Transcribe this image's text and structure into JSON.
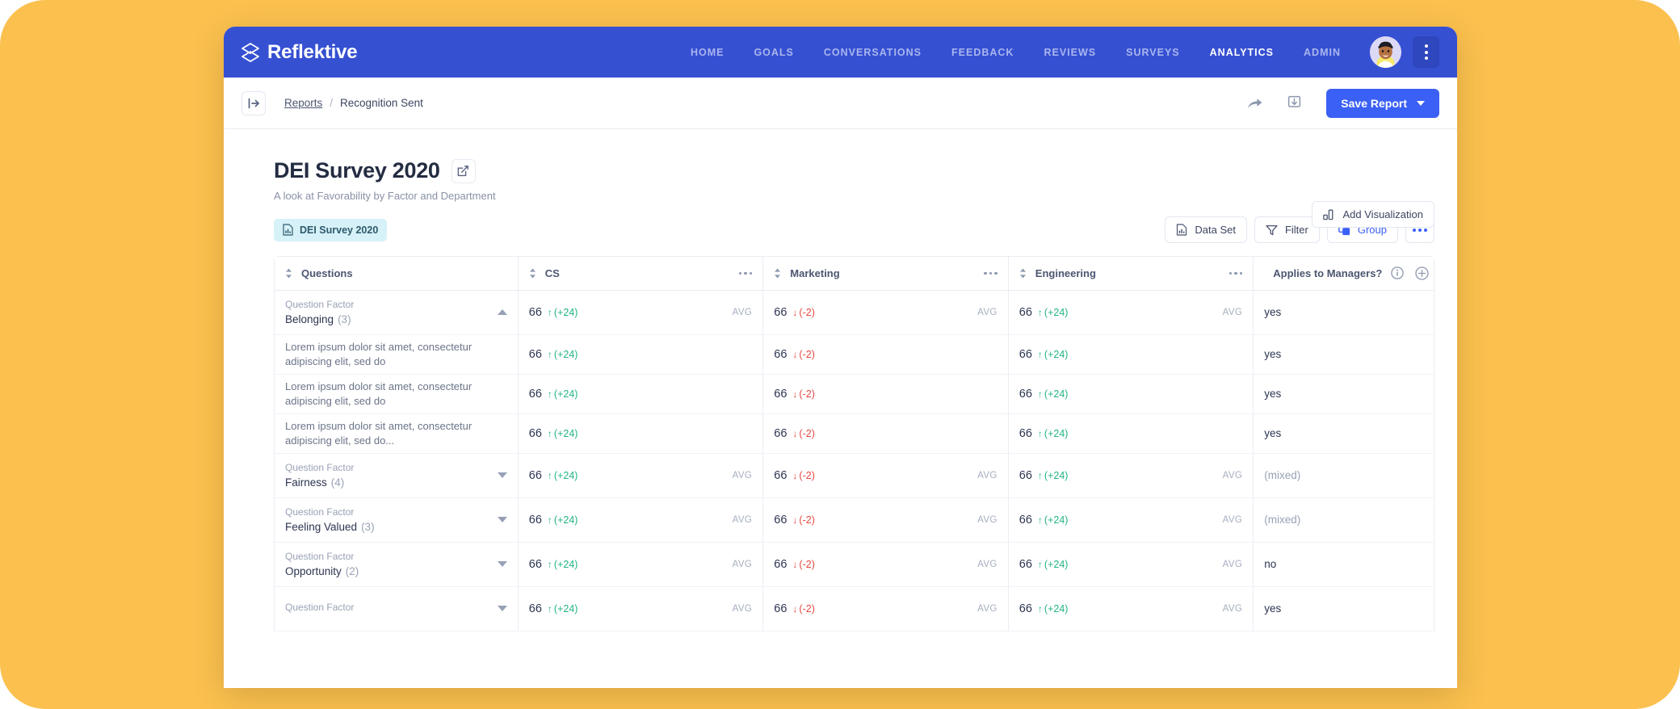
{
  "nav": {
    "brand": "Reflektive",
    "items": [
      {
        "label": "HOME",
        "active": false
      },
      {
        "label": "GOALS",
        "active": false
      },
      {
        "label": "CONVERSATIONS",
        "active": false
      },
      {
        "label": "FEEDBACK",
        "active": false
      },
      {
        "label": "REVIEWS",
        "active": false
      },
      {
        "label": "SURVEYS",
        "active": false
      },
      {
        "label": "ANALYTICS",
        "active": true
      },
      {
        "label": "ADMIN",
        "active": false
      }
    ],
    "brand_color": "#3650D2"
  },
  "breadcrumb": {
    "link": "Reports",
    "separator": "/",
    "current": "Recognition Sent"
  },
  "toolbar": {
    "save_label": "Save Report"
  },
  "header": {
    "title": "DEI Survey 2020",
    "subtitle": "A look at Favorability by Factor and Department",
    "add_visualization_label": "Add Visualization"
  },
  "chip": {
    "label": "DEI Survey 2020"
  },
  "actions": {
    "data_set_label": "Data Set",
    "filter_label": "Filter",
    "group_label": "Group"
  },
  "table": {
    "columns": [
      {
        "label": "Questions",
        "kind": "questions",
        "menu": false
      },
      {
        "label": "CS",
        "kind": "dept",
        "menu": true
      },
      {
        "label": "Marketing",
        "kind": "dept",
        "menu": true
      },
      {
        "label": "Engineering",
        "kind": "dept",
        "menu": true
      },
      {
        "label": "Applies to Managers?",
        "kind": "flag",
        "menu": false
      }
    ],
    "avg_label": "AVG",
    "factor_label": "Question Factor",
    "rows": [
      {
        "type": "group",
        "factor": "Belonging",
        "count": "(3)",
        "expanded": true,
        "cs": {
          "score": "66",
          "delta": "(+24)",
          "dir": "up",
          "avg": "AVG"
        },
        "marketing": {
          "score": "66",
          "delta": "(-2)",
          "dir": "down",
          "avg": "AVG"
        },
        "engineering": {
          "score": "66",
          "delta": "(+24)",
          "dir": "up",
          "avg": "AVG"
        },
        "managers": "yes",
        "managers_muted": false
      },
      {
        "type": "question",
        "text": "Lorem ipsum dolor sit amet, consectetur adipiscing elit, sed do",
        "cs": {
          "score": "66",
          "delta": "(+24)",
          "dir": "up",
          "avg": ""
        },
        "marketing": {
          "score": "66",
          "delta": "(-2)",
          "dir": "down",
          "avg": ""
        },
        "engineering": {
          "score": "66",
          "delta": "(+24)",
          "dir": "up",
          "avg": ""
        },
        "managers": "yes",
        "managers_muted": false
      },
      {
        "type": "question",
        "text": "Lorem ipsum dolor sit amet, consectetur adipiscing elit, sed do",
        "cs": {
          "score": "66",
          "delta": "(+24)",
          "dir": "up",
          "avg": ""
        },
        "marketing": {
          "score": "66",
          "delta": "(-2)",
          "dir": "down",
          "avg": ""
        },
        "engineering": {
          "score": "66",
          "delta": "(+24)",
          "dir": "up",
          "avg": ""
        },
        "managers": "yes",
        "managers_muted": false
      },
      {
        "type": "question",
        "text": "Lorem ipsum dolor sit amet, consectetur adipiscing elit, sed do...",
        "cs": {
          "score": "66",
          "delta": "(+24)",
          "dir": "up",
          "avg": ""
        },
        "marketing": {
          "score": "66",
          "delta": "(-2)",
          "dir": "down",
          "avg": ""
        },
        "engineering": {
          "score": "66",
          "delta": "(+24)",
          "dir": "up",
          "avg": ""
        },
        "managers": "yes",
        "managers_muted": false
      },
      {
        "type": "group",
        "factor": "Fairness",
        "count": "(4)",
        "expanded": false,
        "cs": {
          "score": "66",
          "delta": "(+24)",
          "dir": "up",
          "avg": "AVG"
        },
        "marketing": {
          "score": "66",
          "delta": "(-2)",
          "dir": "down",
          "avg": "AVG"
        },
        "engineering": {
          "score": "66",
          "delta": "(+24)",
          "dir": "up",
          "avg": "AVG"
        },
        "managers": "(mixed)",
        "managers_muted": true
      },
      {
        "type": "group",
        "factor": "Feeling Valued",
        "count": "(3)",
        "expanded": false,
        "cs": {
          "score": "66",
          "delta": "(+24)",
          "dir": "up",
          "avg": "AVG"
        },
        "marketing": {
          "score": "66",
          "delta": "(-2)",
          "dir": "down",
          "avg": "AVG"
        },
        "engineering": {
          "score": "66",
          "delta": "(+24)",
          "dir": "up",
          "avg": "AVG"
        },
        "managers": "(mixed)",
        "managers_muted": true
      },
      {
        "type": "group",
        "factor": "Opportunity",
        "count": "(2)",
        "expanded": false,
        "cs": {
          "score": "66",
          "delta": "(+24)",
          "dir": "up",
          "avg": "AVG"
        },
        "marketing": {
          "score": "66",
          "delta": "(-2)",
          "dir": "down",
          "avg": "AVG"
        },
        "engineering": {
          "score": "66",
          "delta": "(+24)",
          "dir": "up",
          "avg": "AVG"
        },
        "managers": "no",
        "managers_muted": false
      },
      {
        "type": "group",
        "factor": "",
        "count": "",
        "expanded": false,
        "cs": {
          "score": "66",
          "delta": "(+24)",
          "dir": "up",
          "avg": "AVG"
        },
        "marketing": {
          "score": "66",
          "delta": "(-2)",
          "dir": "down",
          "avg": "AVG"
        },
        "engineering": {
          "score": "66",
          "delta": "(+24)",
          "dir": "up",
          "avg": "AVG"
        },
        "managers": "yes",
        "managers_muted": false
      }
    ]
  },
  "colors": {
    "page_background": "#FBC04E",
    "nav_blue": "#3650D2",
    "accent_blue": "#3B60F5",
    "positive": "#21B583",
    "negative": "#E8463F",
    "chip_bg": "#D6F1F8"
  }
}
